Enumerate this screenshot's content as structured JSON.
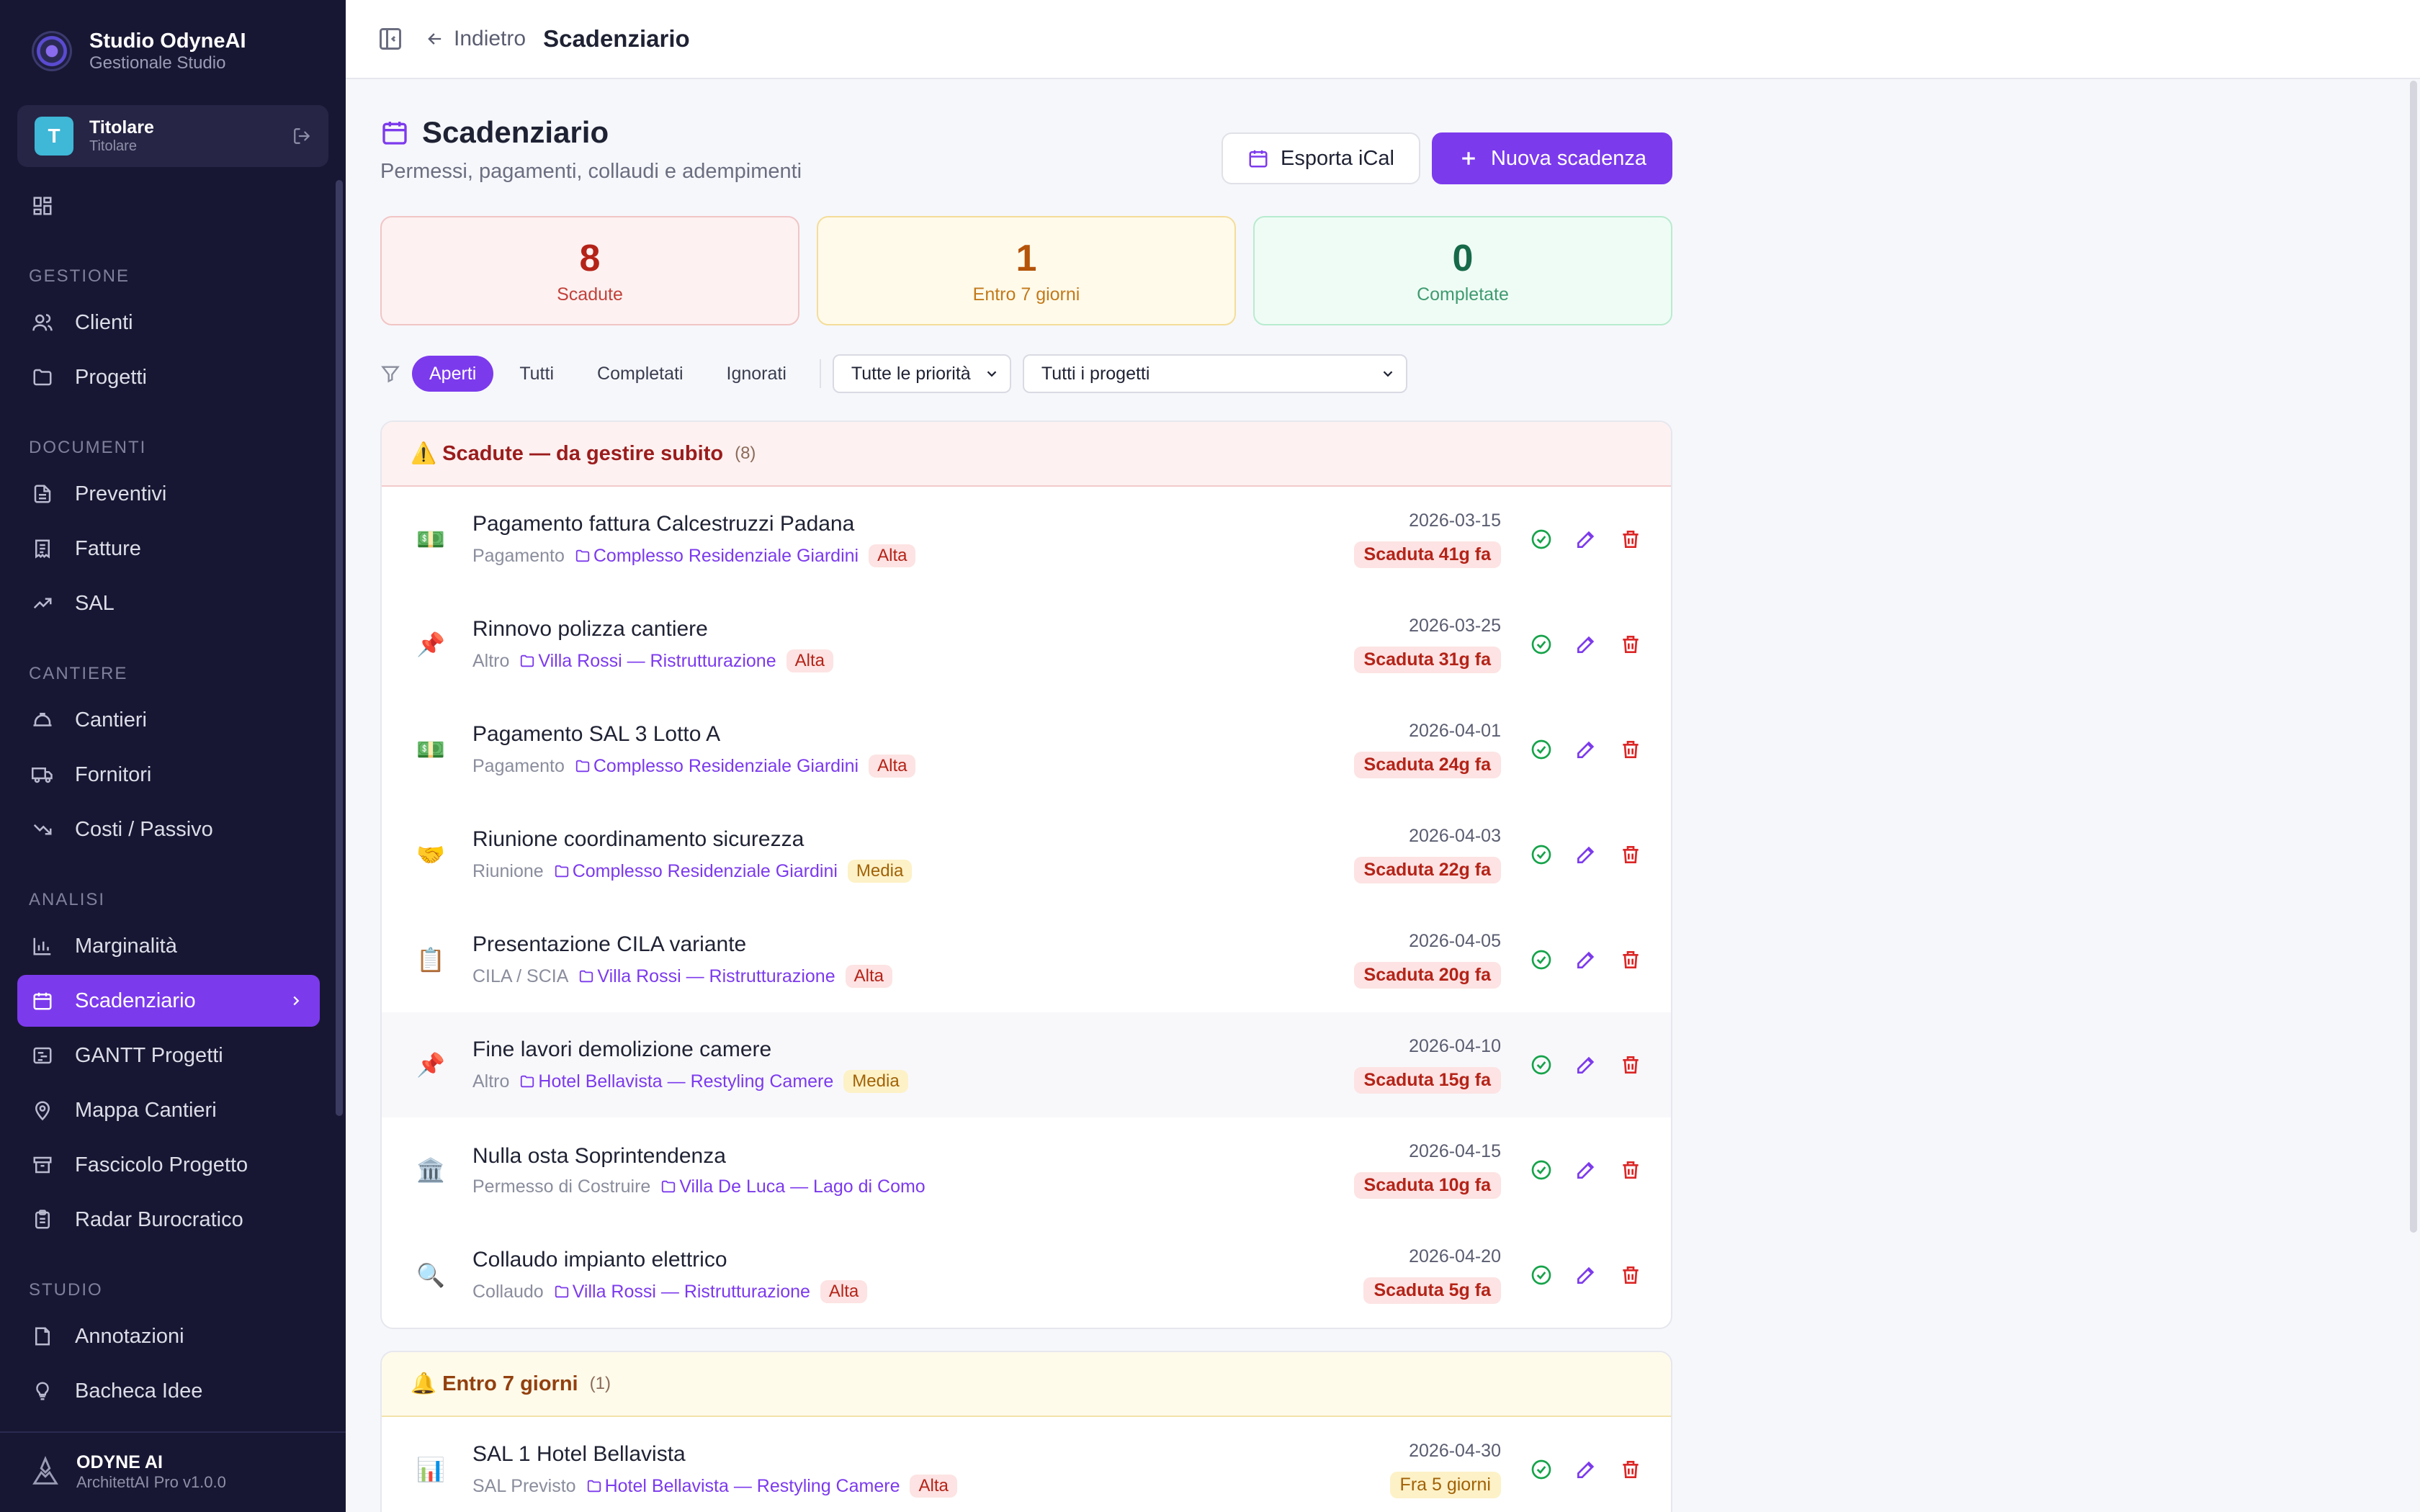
{
  "sidebar": {
    "brand_title": "Studio OdyneAI",
    "brand_sub": "Gestionale Studio",
    "user_initial": "T",
    "user_name": "Titolare",
    "user_role": "Titolare",
    "dashboard": "Dashboard",
    "sections": {
      "gestione": "GESTIONE",
      "documenti": "DOCUMENTI",
      "cantiere": "CANTIERE",
      "analisi": "ANALISI",
      "studio": "STUDIO"
    },
    "items": {
      "clienti": "Clienti",
      "progetti": "Progetti",
      "preventivi": "Preventivi",
      "fatture": "Fatture",
      "sal": "SAL",
      "cantieri": "Cantieri",
      "fornitori": "Fornitori",
      "costi": "Costi / Passivo",
      "marginalita": "Marginalità",
      "scadenziario": "Scadenziario",
      "gantt": "GANTT Progetti",
      "mappa": "Mappa Cantieri",
      "fascicolo": "Fascicolo Progetto",
      "radar": "Radar Burocratico",
      "annotazioni": "Annotazioni",
      "bacheca": "Bacheca Idee"
    },
    "footer_title": "ODYNE AI",
    "footer_sub": "ArchitettAI Pro v1.0.0"
  },
  "topbar": {
    "back_label": "Indietro",
    "title": "Scadenziario"
  },
  "page": {
    "title": "Scadenziario",
    "subtitle": "Permessi, pagamenti, collaudi e adempimenti",
    "export_label": "Esporta iCal",
    "new_label": "Nuova scadenza"
  },
  "stats": {
    "overdue": {
      "value": "8",
      "label": "Scadute"
    },
    "soon": {
      "value": "1",
      "label": "Entro 7 giorni"
    },
    "done": {
      "value": "0",
      "label": "Completate"
    }
  },
  "filters": {
    "chips": [
      "Aperti",
      "Tutti",
      "Completati",
      "Ignorati"
    ],
    "priority": "Tutte le priorità",
    "project": "Tutti i progetti"
  },
  "overdue_panel": {
    "title": "Scadute — da gestire subito",
    "icon": "⚠️",
    "count": "(8)",
    "rows": [
      {
        "emoji": "💵",
        "title": "Pagamento fattura Calcestruzzi Padana",
        "type": "Pagamento",
        "project": "Complesso Residenziale Giardini",
        "priority": "Alta",
        "date": "2026-03-15",
        "badge": "Scaduta 41g fa"
      },
      {
        "emoji": "📌",
        "title": "Rinnovo polizza cantiere",
        "type": "Altro",
        "project": "Villa Rossi — Ristrutturazione",
        "priority": "Alta",
        "date": "2026-03-25",
        "badge": "Scaduta 31g fa"
      },
      {
        "emoji": "💵",
        "title": "Pagamento SAL 3 Lotto A",
        "type": "Pagamento",
        "project": "Complesso Residenziale Giardini",
        "priority": "Alta",
        "date": "2026-04-01",
        "badge": "Scaduta 24g fa"
      },
      {
        "emoji": "🤝",
        "title": "Riunione coordinamento sicurezza",
        "type": "Riunione",
        "project": "Complesso Residenziale Giardini",
        "priority": "Media",
        "date": "2026-04-03",
        "badge": "Scaduta 22g fa"
      },
      {
        "emoji": "📋",
        "title": "Presentazione CILA variante",
        "type": "CILA / SCIA",
        "project": "Villa Rossi — Ristrutturazione",
        "priority": "Alta",
        "date": "2026-04-05",
        "badge": "Scaduta 20g fa"
      },
      {
        "emoji": "📌",
        "title": "Fine lavori demolizione camere",
        "type": "Altro",
        "project": "Hotel Bellavista — Restyling Camere",
        "priority": "Media",
        "date": "2026-04-10",
        "badge": "Scaduta 15g fa"
      },
      {
        "emoji": "🏛️",
        "title": "Nulla osta Soprintendenza",
        "type": "Permesso di Costruire",
        "project": "Villa De Luca — Lago di Como",
        "priority": "",
        "date": "2026-04-15",
        "badge": "Scaduta 10g fa"
      },
      {
        "emoji": "🔍",
        "title": "Collaudo impianto elettrico",
        "type": "Collaudo",
        "project": "Villa Rossi — Ristrutturazione",
        "priority": "Alta",
        "date": "2026-04-20",
        "badge": "Scaduta 5g fa"
      }
    ]
  },
  "soon_panel": {
    "title": "Entro 7 giorni",
    "icon": "🔔",
    "count": "(1)",
    "rows": [
      {
        "emoji": "📊",
        "title": "SAL 1 Hotel Bellavista",
        "type": "SAL Previsto",
        "project": "Hotel Bellavista — Restyling Camere",
        "priority": "Alta",
        "date": "2026-04-30",
        "badge": "Fra 5 giorni"
      }
    ]
  }
}
